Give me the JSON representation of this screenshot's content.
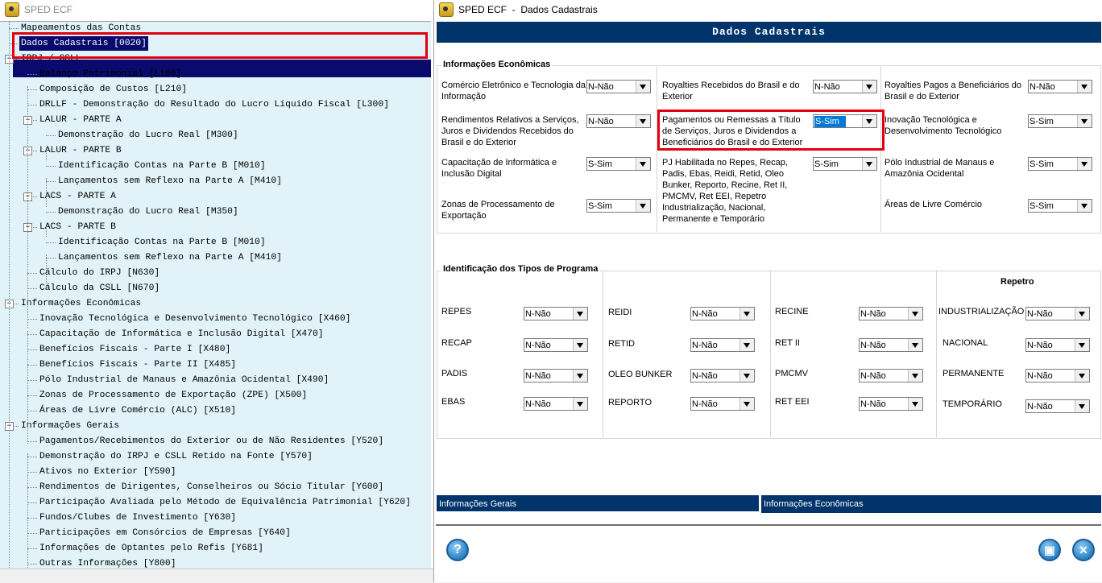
{
  "left_window": {
    "title": "SPED ECF",
    "tree": [
      {
        "label": "Mapeamentos das Contas",
        "level": 0
      },
      {
        "label": "Dados Cadastrais [0020]",
        "level": 0,
        "selected": true
      },
      {
        "label": "IRPJ / CSLL",
        "level": 0,
        "expander": "−"
      },
      {
        "label": "Balanço Patrimonial [L100]",
        "level": 1
      },
      {
        "label": "Composição de Custos [L210]",
        "level": 1
      },
      {
        "label": "DRLLF - Demonstração do Resultado do Lucro Líquido Fiscal [L300]",
        "level": 1
      },
      {
        "label": "LALUR - PARTE A",
        "level": 1,
        "expander": "−"
      },
      {
        "label": "Demonstração do Lucro Real [M300]",
        "level": 2
      },
      {
        "label": "LALUR - PARTE B",
        "level": 1,
        "expander": "−"
      },
      {
        "label": "Identificação Contas na Parte B [M010]",
        "level": 2
      },
      {
        "label": "Lançamentos sem Reflexo na Parte A [M410]",
        "level": 2
      },
      {
        "label": "LACS - PARTE A",
        "level": 1,
        "expander": "−"
      },
      {
        "label": "Demonstração do Lucro Real [M350]",
        "level": 2
      },
      {
        "label": "LACS - PARTE B",
        "level": 1,
        "expander": "−"
      },
      {
        "label": "Identificação Contas na Parte B [M010]",
        "level": 2
      },
      {
        "label": "Lançamentos sem Reflexo na Parte A [M410]",
        "level": 2
      },
      {
        "label": "Cálculo do IRPJ [N630]",
        "level": 1
      },
      {
        "label": "Cálculo da CSLL [N670]",
        "level": 1
      },
      {
        "label": "Informações Econômicas",
        "level": 0,
        "expander": "−"
      },
      {
        "label": "Inovação Tecnológica e Desenvolvimento Tecnológico [X460]",
        "level": 1
      },
      {
        "label": "Capacitação de Informática e Inclusão Digital [X470]",
        "level": 1
      },
      {
        "label": "Benefícios Fiscais - Parte I [X480]",
        "level": 1
      },
      {
        "label": "Benefícios Fiscais - Parte II [X485]",
        "level": 1
      },
      {
        "label": "Pólo Industrial de Manaus e Amazônia Ocidental [X490]",
        "level": 1
      },
      {
        "label": "Zonas de Processamento de Exportação (ZPE) [X500]",
        "level": 1
      },
      {
        "label": "Áreas de Livre Comércio (ALC) [X510]",
        "level": 1
      },
      {
        "label": "Informações Gerais",
        "level": 0,
        "expander": "−"
      },
      {
        "label": "Pagamentos/Recebimentos do Exterior ou de Não Residentes [Y520]",
        "level": 1
      },
      {
        "label": "Demonstração do IRPJ e CSLL Retido na Fonte [Y570]",
        "level": 1
      },
      {
        "label": "Ativos no Exterior [Y590]",
        "level": 1
      },
      {
        "label": "Rendimentos de Dirigentes, Conselheiros ou Sócio Titular [Y600]",
        "level": 1
      },
      {
        "label": "Participação Avaliada pelo Método de Equivalência Patrimonial [Y620]",
        "level": 1
      },
      {
        "label": "Fundos/Clubes de Investimento [Y630]",
        "level": 1
      },
      {
        "label": "Participações em Consórcios de Empresas [Y640]",
        "level": 1
      },
      {
        "label": "Informações de Optantes pelo Refis [Y681]",
        "level": 1
      },
      {
        "label": "Outras Informações [Y800]",
        "level": 1
      }
    ]
  },
  "dialog": {
    "title": "SPED ECF  -  Dados Cadastrais",
    "header": "Dados Cadastrais",
    "econ": {
      "title": "Informações Econômicas",
      "fields": [
        {
          "label": "Comércio Eletrônico e Tecnologia da Informação",
          "value": "N-Não"
        },
        {
          "label": "Royalties Recebidos do Brasil e do Exterior",
          "value": "N-Não"
        },
        {
          "label": "Royalties Pagos a Beneficiários do Brasil e do Exterior",
          "value": "N-Não"
        },
        {
          "label": "Rendimentos Relativos a Serviços, Juros e Dividendos Recebidos do Brasil e do Exterior",
          "value": "N-Não"
        },
        {
          "label": "Pagamentos ou Remessas a Título de Serviços, Juros e Dividendos a Beneficiários do Brasil e do Exterior",
          "value": "S-Sim"
        },
        {
          "label": "Inovação Tecnológica e Desenvolvimento Tecnológico",
          "value": "S-Sim"
        },
        {
          "label": "Capacitação de Informática e Inclusão Digital",
          "value": "S-Sim"
        },
        {
          "label": "PJ Habilitada no Repes, Recap, Padis, Ebas, Reidi, Retid, Oleo Bunker, Reporto, Recine, Ret II, PMCMV, Ret EEI, Repetro Industrialização, Nacional, Permanente e Temporário",
          "value": "S-Sim"
        },
        {
          "label": "Pólo Industrial de Manaus e Amazônia Ocidental",
          "value": "S-Sim"
        },
        {
          "label": "Zonas de Processamento de Exportação",
          "value": "S-Sim"
        },
        {
          "label": "Áreas de Livre Comércio",
          "value": "S-Sim"
        }
      ]
    },
    "programs": {
      "title": "Identificação dos Tipos de Programa",
      "repetro_title": "Repetro",
      "fields": [
        {
          "label": "REPES",
          "value": "N-Não"
        },
        {
          "label": "RECAP",
          "value": "N-Não"
        },
        {
          "label": "PADIS",
          "value": "N-Não"
        },
        {
          "label": "EBAS",
          "value": "N-Não"
        },
        {
          "label": "REIDI",
          "value": "N-Não"
        },
        {
          "label": "RETID",
          "value": "N-Não"
        },
        {
          "label": "OLEO BUNKER",
          "value": "N-Não"
        },
        {
          "label": "REPORTO",
          "value": "N-Não"
        },
        {
          "label": "RECINE",
          "value": "N-Não"
        },
        {
          "label": "RET II",
          "value": "N-Não"
        },
        {
          "label": "PMCMV",
          "value": "N-Não"
        },
        {
          "label": "RET EEI",
          "value": "N-Não"
        },
        {
          "label": "INDUSTRIALIZAÇÃO",
          "value": "N-Não"
        },
        {
          "label": "NACIONAL",
          "value": "N-Não"
        },
        {
          "label": "PERMANENTE",
          "value": "N-Não"
        },
        {
          "label": "TEMPORÁRIO",
          "value": "N-Não"
        }
      ]
    },
    "tabs": [
      "Informações Gerais",
      "Informações Econômicas"
    ],
    "buttons": {
      "help": "?",
      "save": "▣",
      "close": "✕"
    }
  },
  "colors": {
    "header": "#00346b",
    "tree_bg": "#e1f3f9",
    "highlight": "#e00010",
    "selection": "#0a0a6e"
  }
}
